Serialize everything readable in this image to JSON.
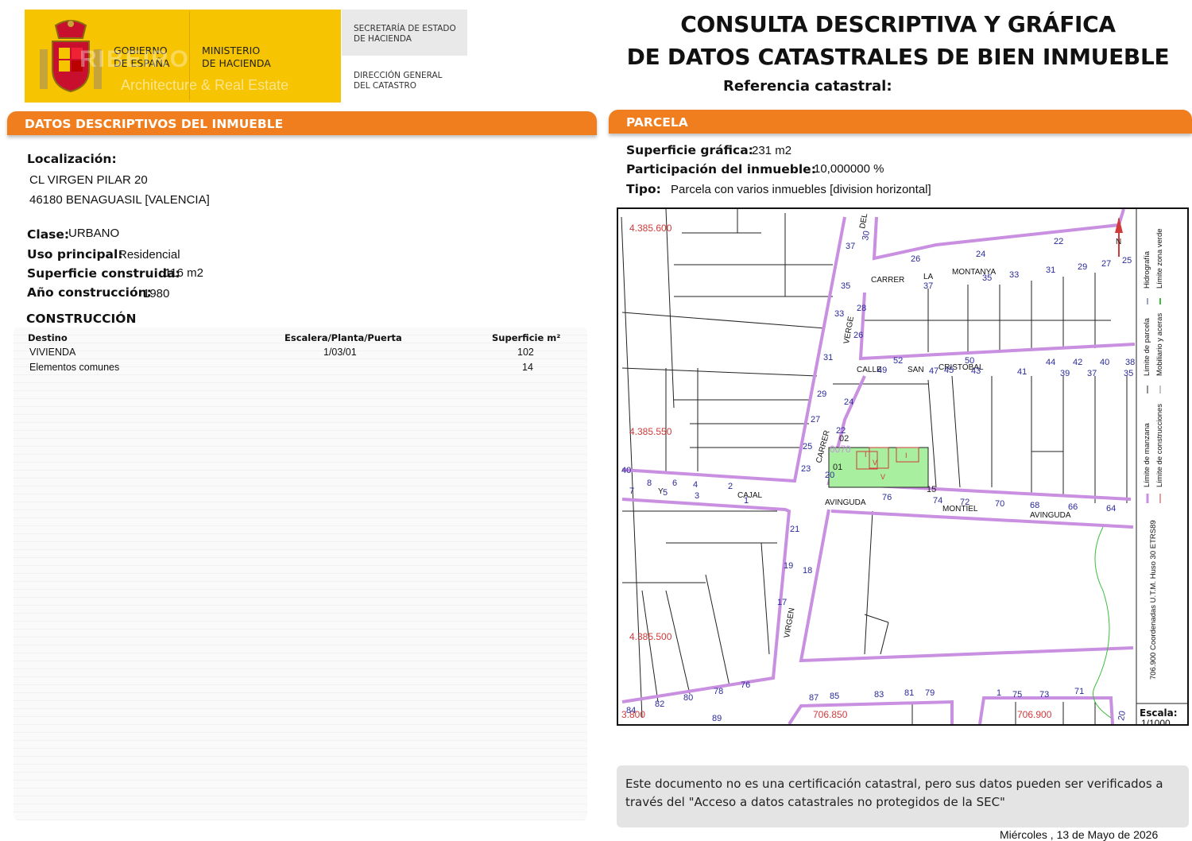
{
  "header": {
    "gobierno": [
      "GOBIERNO",
      "DE ESPAÑA"
    ],
    "ministerio": [
      "MINISTERIO",
      "DE HACIENDA"
    ],
    "secretaria": [
      "SECRETARÍA DE ESTADO",
      "DE HACIENDA"
    ],
    "direccion": [
      "DIRECCIÓN GENERAL",
      "DEL CATASTRO"
    ],
    "watermark_logo": "RIBEIRO",
    "watermark_text": "Architecture & Real Estate",
    "title_line1": "CONSULTA DESCRIPTIVA Y GRÁFICA",
    "title_line2": "DE DATOS CATASTRALES DE BIEN INMUEBLE",
    "referencia_label": "Referencia catastral:",
    "colors": {
      "yellow": "#f6c400",
      "orange": "#f07e1e"
    }
  },
  "datos": {
    "section_title": "DATOS DESCRIPTIVOS DEL INMUEBLE",
    "localizacion_label": "Localización:",
    "address_line1": "CL VIRGEN PILAR 20",
    "address_line2": "46180 BENAGUASIL [VALENCIA]",
    "clase_label": "Clase:",
    "clase_value": "URBANO",
    "uso_label": "Uso principal:",
    "uso_value": "Residencial",
    "superficie_label": "Superficie construida:",
    "superficie_value": "116 m2",
    "anio_label": "Año construcción:",
    "anio_value": "1980",
    "construccion_title": "CONSTRUCCIÓN",
    "table_headers": [
      "Destino",
      "Escalera/Planta/Puerta",
      "Superficie m²"
    ],
    "rows": [
      [
        "VIVIENDA",
        "1/03/01",
        "102"
      ],
      [
        "Elementos comunes",
        "",
        "14"
      ]
    ]
  },
  "parcela": {
    "section_title": "PARCELA",
    "superficie_label": "Superficie gráfica:",
    "superficie_value": "231 m2",
    "participacion_label": "Participación del inmueble:",
    "participacion_value": "10,000000 %",
    "tipo_label": "Tipo:",
    "tipo_value": "Parcela con varios inmuebles [division horizontal]"
  },
  "map": {
    "coords": [
      "4.385.600",
      "4.385.550",
      "4.385.500",
      "706.850",
      "706.900",
      "3.800"
    ],
    "streets": [
      "CARRER",
      "LA",
      "MONTANYA",
      "CALLE",
      "SAN",
      "CRISTOBAL",
      "CAJAL",
      "AVINGUDA",
      "MONTIEL",
      "AVINGUDA",
      "CARRER",
      "VERGE",
      "DEL",
      "VIRGEN",
      "Y"
    ],
    "numbers": [
      "26",
      "24",
      "22",
      "37",
      "35",
      "33",
      "31",
      "29",
      "27",
      "25",
      "37",
      "35",
      "33",
      "28",
      "26",
      "52",
      "50",
      "49",
      "47",
      "45",
      "43",
      "41",
      "39",
      "37",
      "35",
      "44",
      "42",
      "40",
      "38",
      "31",
      "29",
      "27",
      "25",
      "24",
      "22",
      "23",
      "21",
      "19",
      "17",
      "20",
      "18",
      "02",
      "01",
      "15",
      "8",
      "6",
      "4",
      "2",
      "5",
      "3",
      "1",
      "7",
      "40",
      "74",
      "72",
      "70",
      "68",
      "66",
      "64",
      "76",
      "84",
      "82",
      "80",
      "78",
      "76",
      "89",
      "87",
      "85",
      "83",
      "81",
      "79",
      "1",
      "75",
      "73",
      "71",
      "30",
      "20"
    ],
    "legend": [
      "Hidrografía",
      "Límite zona verde",
      "Límite de parcela",
      "Mobiliario y aceras",
      "Límite de manzana",
      "Límite de construcciones"
    ],
    "coords_note": "706.900 Coordenadas U.T.M. Huso 30 ETRS89",
    "escala_label": "Escala:",
    "escala_value": "1/1000",
    "north": "N",
    "plot_label": "0070",
    "plot_marks": [
      "V",
      "V",
      "I",
      "I"
    ],
    "colors": {
      "block": "#c98fe0",
      "parcel": "#222222",
      "plot": "#a8f0a0",
      "coord": "#d03a3a",
      "number": "#2a2a9a",
      "green": "#3cbf3c"
    }
  },
  "footer": {
    "note": "Este documento no es una certificación catastral, pero sus datos pueden ser verificados a través del \"Acceso a datos catastrales no protegidos de la SEC\"",
    "date": "Miércoles , 13 de Mayo de 2026"
  }
}
